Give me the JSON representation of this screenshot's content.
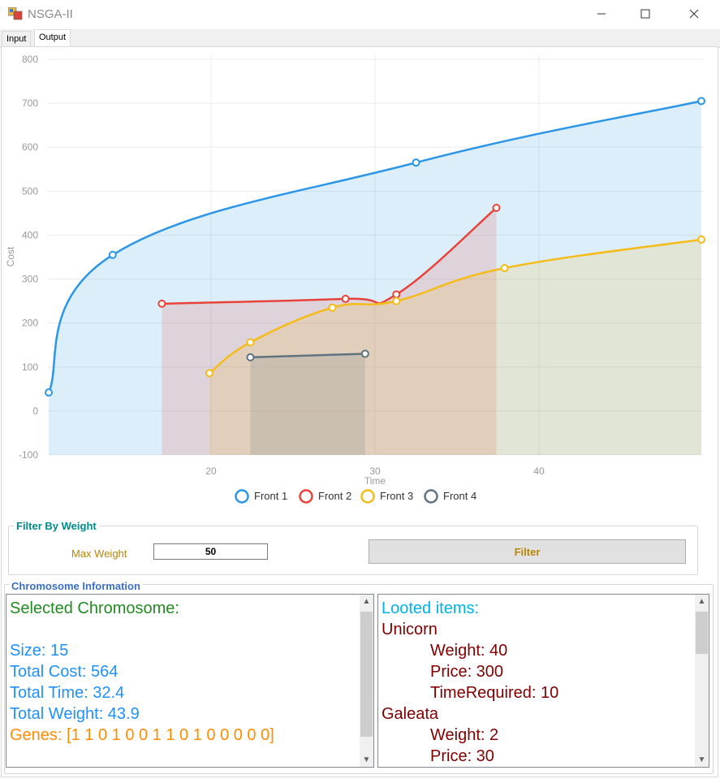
{
  "window": {
    "title": "NSGA-II"
  },
  "tabs": [
    {
      "label": "Input"
    },
    {
      "label": "Output"
    }
  ],
  "chart_data": {
    "type": "line",
    "title": "",
    "xlabel": "Time",
    "ylabel": "Cost",
    "xlim": [
      10,
      50
    ],
    "ylim": [
      -100,
      800
    ],
    "x_ticks": [
      "20",
      "30",
      "40"
    ],
    "y_ticks": [
      "800",
      "700",
      "600",
      "500",
      "400",
      "300",
      "200",
      "100",
      "0",
      "-100"
    ],
    "grid": true,
    "legend_position": "bottom",
    "series": [
      {
        "name": "Front 1",
        "color": "#2b95e8",
        "x": [
          10.1,
          14.0,
          32.5,
          49.9
        ],
        "y": [
          42,
          355,
          565,
          705
        ]
      },
      {
        "name": "Front 2",
        "color": "#e8433a",
        "x": [
          17.0,
          28.2,
          31.3,
          37.4
        ],
        "y": [
          244,
          255,
          265,
          462
        ]
      },
      {
        "name": "Front 3",
        "color": "#f5bc19",
        "x": [
          19.9,
          22.4,
          27.4,
          31.3,
          37.9,
          49.9
        ],
        "y": [
          86,
          156,
          235,
          250,
          325,
          390
        ]
      },
      {
        "name": "Front 4",
        "color": "#5f7381",
        "x": [
          22.4,
          29.4
        ],
        "y": [
          122,
          130
        ]
      }
    ]
  },
  "filter": {
    "title": "Filter By Weight",
    "max_weight_label": "Max Weight",
    "max_weight_value": "50",
    "button_label": "Filter"
  },
  "chromosome": {
    "title": "Chromosome Information",
    "selected_heading": "Selected Chromosome:",
    "size": "Size: 15",
    "total_cost": "Total Cost: 564",
    "total_time": "Total Time: 32.4",
    "total_weight": "Total Weight: 43.9",
    "genes": "Genes: [1 1 0 1 0 0 1 1 0 1 0 0 0 0 0]"
  },
  "looted": {
    "heading": "Looted items:",
    "items": [
      {
        "name": "Unicorn",
        "weight": "Weight: 40",
        "price": "Price: 300",
        "time": "TimeRequired: 10"
      },
      {
        "name": "Galeata",
        "weight": "Weight: 2",
        "price": "Price: 30"
      }
    ]
  }
}
